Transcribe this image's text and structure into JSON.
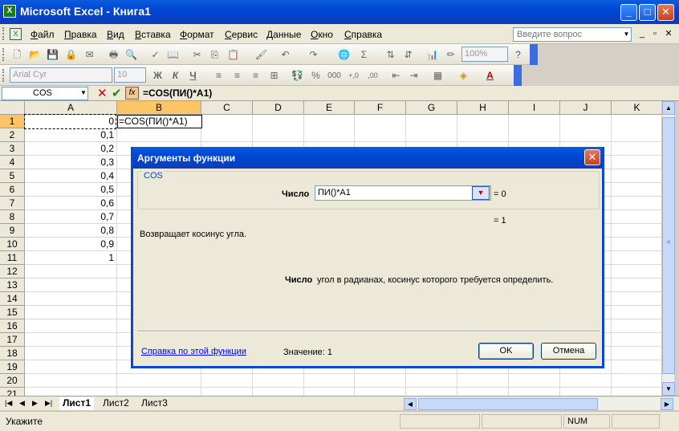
{
  "window": {
    "title": "Microsoft Excel - Книга1",
    "app_icon_text": "X",
    "min": "_",
    "max": "□",
    "close": "✕"
  },
  "menu": {
    "items": [
      "Файл",
      "Правка",
      "Вид",
      "Вставка",
      "Формат",
      "Сервис",
      "Данные",
      "Окно",
      "Справка"
    ],
    "help_placeholder": "Введите вопрос",
    "help_arrow": "▼",
    "mdi_min": "_",
    "mdi_restore": "▫",
    "mdi_close": "✕"
  },
  "toolbar": {
    "zoom": "100%",
    "font_name": "Arial Cyr",
    "font_size": "10",
    "bold": "Ж",
    "italic": "К",
    "underline": "Ч",
    "currency": "💱",
    "percent": "%",
    "thousands": "000",
    "inc_decimals": "+,0",
    "dec_decimals": ",00",
    "sum": "Σ",
    "font_color_glyph": "A"
  },
  "formula_bar": {
    "name_box": "COS",
    "name_arrow": "▼",
    "cancel": "✕",
    "enter": "✔",
    "fx": "fx",
    "formula": "=COS(ПИ()*A1)"
  },
  "grid": {
    "columns": [
      "A",
      "B",
      "C",
      "D",
      "E",
      "F",
      "G",
      "H",
      "I",
      "J",
      "K"
    ],
    "rows": [
      "1",
      "2",
      "3",
      "4",
      "5",
      "6",
      "7",
      "8",
      "9",
      "10",
      "11",
      "12",
      "13",
      "14",
      "15",
      "16",
      "17",
      "18",
      "19",
      "20",
      "21"
    ],
    "col_a_values": [
      "0",
      "0,1",
      "0,2",
      "0,3",
      "0,4",
      "0,5",
      "0,6",
      "0,7",
      "0,8",
      "0,9",
      "1"
    ],
    "b1_edit": "=COS(ПИ()*A1)",
    "active_column": "B",
    "active_row": "1"
  },
  "scroll": {
    "up": "▲",
    "down": "▼",
    "left": "◀",
    "right": "▶",
    "grip": "≡"
  },
  "sheets": {
    "nav": [
      "|◀",
      "◀",
      "▶",
      "▶|"
    ],
    "tabs": [
      "Лист1",
      "Лист2",
      "Лист3"
    ],
    "active": "Лист1"
  },
  "status": {
    "mode": "Укажите",
    "num": "NUM"
  },
  "dialog": {
    "title": "Аргументы функции",
    "close": "✕",
    "function_name": "COS",
    "arg_label": "Число",
    "arg_value": "ПИ()*A1",
    "collapse_glyph": "▼",
    "arg_result": "= 0",
    "function_result": "= 1",
    "description": "Возвращает косинус угла.",
    "arg_desc_label": "Число",
    "arg_desc_text": "угол в радианах, косинус которого требуется определить.",
    "help_link": "Справка по этой функции",
    "value_label": "Значение: 1",
    "ok": "OK",
    "cancel": "Отмена"
  }
}
